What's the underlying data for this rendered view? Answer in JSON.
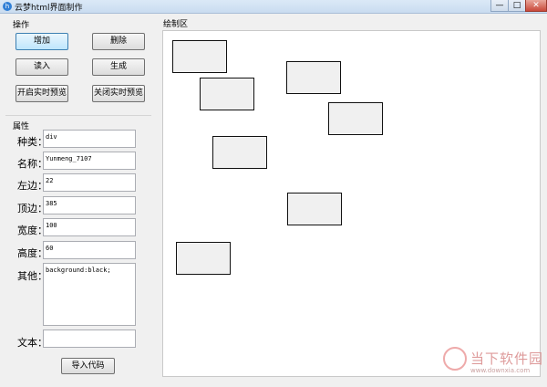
{
  "window": {
    "title": "云梦html界面制作",
    "min": "—",
    "max": "□",
    "close": "✕"
  },
  "operations": {
    "group_label": "操作",
    "add": "增加",
    "delete": "删除",
    "read": "读入",
    "generate": "生成",
    "start_preview": "开启实时预览",
    "stop_preview": "关闭实时预览"
  },
  "properties": {
    "group_label": "属性",
    "type_label": "种类：",
    "type_value": "div",
    "name_label": "名称：",
    "name_value": "Yunmeng_7107",
    "left_label": "左边：",
    "left_value": "22",
    "top_label": "顶边：",
    "top_value": "385",
    "width_label": "宽度：",
    "width_value": "100",
    "height_label": "高度：",
    "height_value": "60",
    "other_label": "其他：",
    "other_value": "background:black;",
    "text_label": "文本：",
    "text_value": "",
    "import_button": "导入代码"
  },
  "drawing": {
    "label": "绘制区"
  },
  "watermark": {
    "text": "当下软件园",
    "url": "www.downxia.com"
  }
}
